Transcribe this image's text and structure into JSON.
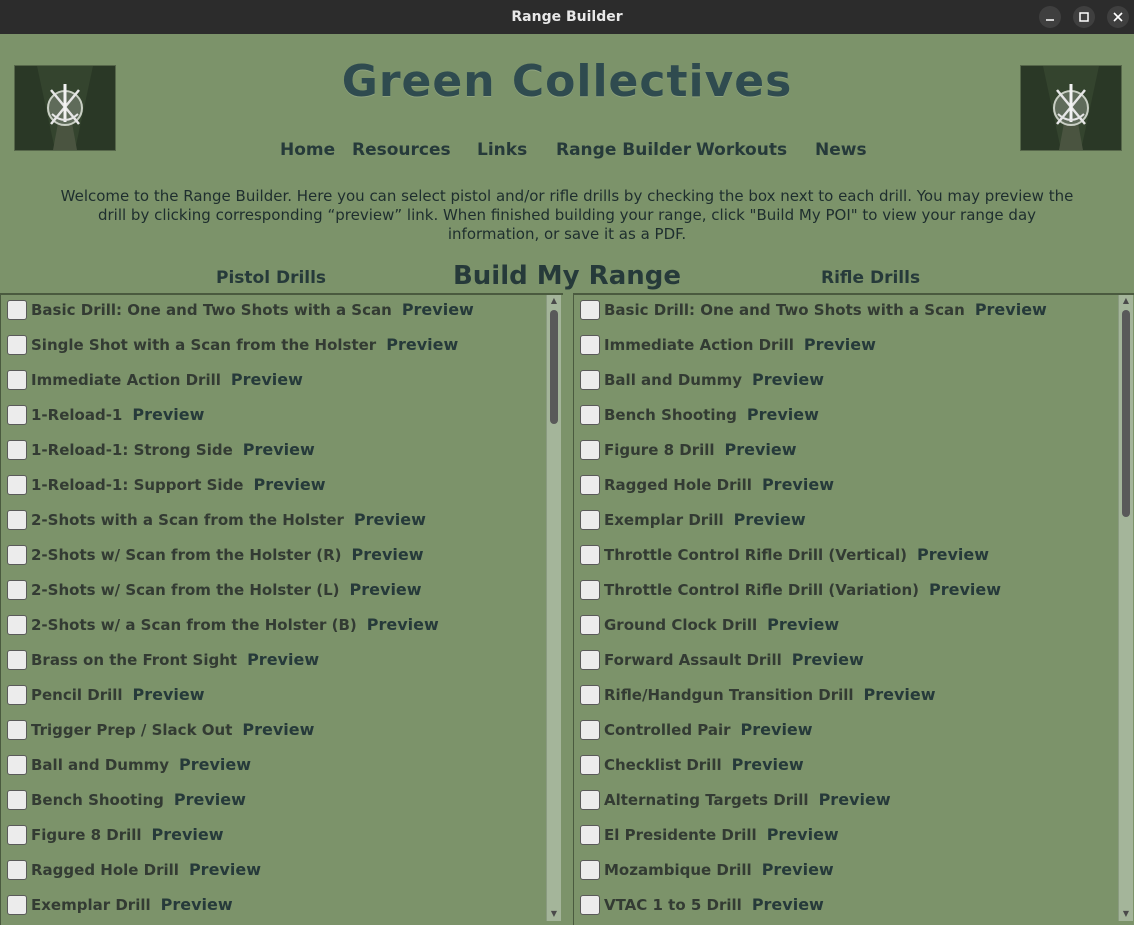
{
  "window": {
    "title": "Range Builder",
    "controls": {
      "minimize": "–",
      "maximize": "☐",
      "close": "✕"
    }
  },
  "header": {
    "site_title": "Green Collectives",
    "logo_icon": "special-forces-crest-icon",
    "nav": [
      {
        "label": "Home"
      },
      {
        "label": "Resources"
      },
      {
        "label": "Links"
      },
      {
        "label": "Range Builder"
      },
      {
        "label": "Workouts"
      },
      {
        "label": "News"
      }
    ],
    "intro": "Welcome to the Range Builder. Here you can select pistol and/or rifle drills by checking the box next to each drill. You may preview the drill by clicking corresponding “preview” link. When finished building your range, click \"Build My POI\" to view your range day information, or save it as a PDF."
  },
  "columns": {
    "pistol_heading": "Pistol Drills",
    "build_button": "Build My Range",
    "rifle_heading": "Rifle Drills"
  },
  "preview_label": "Preview",
  "pistol_drills": [
    {
      "name": "Basic Drill: One and Two Shots with a Scan"
    },
    {
      "name": "Single Shot with a Scan from the Holster"
    },
    {
      "name": "Immediate Action Drill"
    },
    {
      "name": "1-Reload-1"
    },
    {
      "name": "1-Reload-1: Strong Side"
    },
    {
      "name": "1-Reload-1: Support Side"
    },
    {
      "name": "2-Shots with a Scan from the Holster"
    },
    {
      "name": "2-Shots w/ Scan from the Holster (R)"
    },
    {
      "name": "2-Shots w/ Scan from the Holster (L)"
    },
    {
      "name": "2-Shots w/ a Scan from the Holster (B)"
    },
    {
      "name": "Brass on the Front Sight"
    },
    {
      "name": "Pencil Drill"
    },
    {
      "name": "Trigger Prep / Slack Out"
    },
    {
      "name": "Ball and Dummy"
    },
    {
      "name": "Bench Shooting"
    },
    {
      "name": "Figure 8 Drill"
    },
    {
      "name": "Ragged Hole Drill"
    },
    {
      "name": "Exemplar Drill"
    }
  ],
  "rifle_drills": [
    {
      "name": "Basic Drill: One and Two Shots with a Scan"
    },
    {
      "name": "Immediate Action Drill"
    },
    {
      "name": "Ball and Dummy"
    },
    {
      "name": "Bench Shooting"
    },
    {
      "name": "Figure 8 Drill"
    },
    {
      "name": "Ragged Hole Drill"
    },
    {
      "name": "Exemplar Drill"
    },
    {
      "name": "Throttle Control Rifle Drill (Vertical)"
    },
    {
      "name": "Throttle Control Rifle Drill (Variation)"
    },
    {
      "name": "Ground Clock Drill"
    },
    {
      "name": "Forward Assault Drill"
    },
    {
      "name": "Rifle/Handgun Transition Drill"
    },
    {
      "name": "Controlled Pair"
    },
    {
      "name": "Checklist Drill"
    },
    {
      "name": "Alternating Targets Drill"
    },
    {
      "name": "El Presidente Drill"
    },
    {
      "name": "Mozambique Drill"
    },
    {
      "name": "VTAC 1 to 5 Drill"
    }
  ],
  "colors": {
    "background": "#7c936a",
    "titlebar": "#2c2c2c",
    "heading_text": "#2f4b4f"
  }
}
